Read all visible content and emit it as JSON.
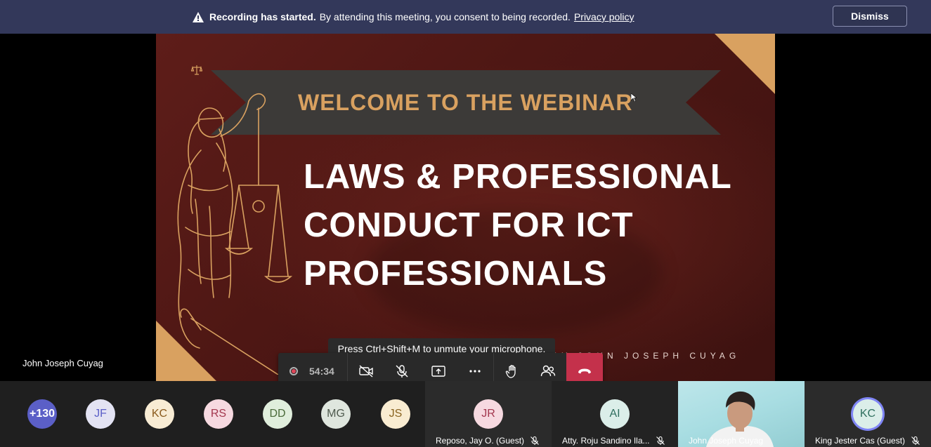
{
  "banner": {
    "icon": "warning-icon",
    "bold_text": "Recording has started.",
    "message": "By attending this meeting, you consent to being recorded.",
    "link": "Privacy policy",
    "dismiss_label": "Dismiss"
  },
  "slide": {
    "welcome": "WELCOME TO THE WEBINAR",
    "title_line1": "LAWS & PROFESSIONAL",
    "title_line2": "CONDUCT FOR ICT",
    "title_line3": "PROFESSIONALS",
    "hosted_by": "HOSTED BY:JOHN JOSEPH CUYAG",
    "accent_color": "#d9a160",
    "background_color": "#5e1d19"
  },
  "presenter_name": "John Joseph Cuyag",
  "tooltip": "Press Ctrl+Shift+M to unmute your microphone.",
  "controls": {
    "timer": "54:34",
    "buttons": [
      "camera-off-icon",
      "mic-off-icon",
      "share-icon",
      "more-icon",
      "raise-hand-icon",
      "participants-icon",
      "hang-up-icon"
    ],
    "hangup_color": "#c4314b"
  },
  "participants": {
    "overflow_count": "+130",
    "avatars": [
      {
        "initials": "JF",
        "bg": "#e3e3f3",
        "fg": "#5b5fc7"
      },
      {
        "initials": "KC",
        "bg": "#f8ecd4",
        "fg": "#8a5a1c"
      },
      {
        "initials": "RS",
        "bg": "#f6d9e0",
        "fg": "#a3374e"
      },
      {
        "initials": "DD",
        "bg": "#e0eedc",
        "fg": "#4b6b3a"
      },
      {
        "initials": "MG",
        "bg": "#dfe6de",
        "fg": "#4f5a4e"
      },
      {
        "initials": "JS",
        "bg": "#f9ecd1",
        "fg": "#8a6420"
      }
    ],
    "tiles": [
      {
        "initials": "JR",
        "name": "Reposo, Jay O. (Guest)",
        "bg": "#f6d9e0",
        "fg": "#a3374e"
      },
      {
        "initials": "AI",
        "name": "Atty. Roju Sandino Ila...",
        "bg": "#dbeee9",
        "fg": "#2f6f5f"
      },
      {
        "initials": "",
        "name": "John Joseph Cuyag"
      },
      {
        "initials": "KC",
        "name": "King Jester Cas (Guest)",
        "bg": "#dbeee9",
        "fg": "#2f6f5f"
      }
    ]
  }
}
